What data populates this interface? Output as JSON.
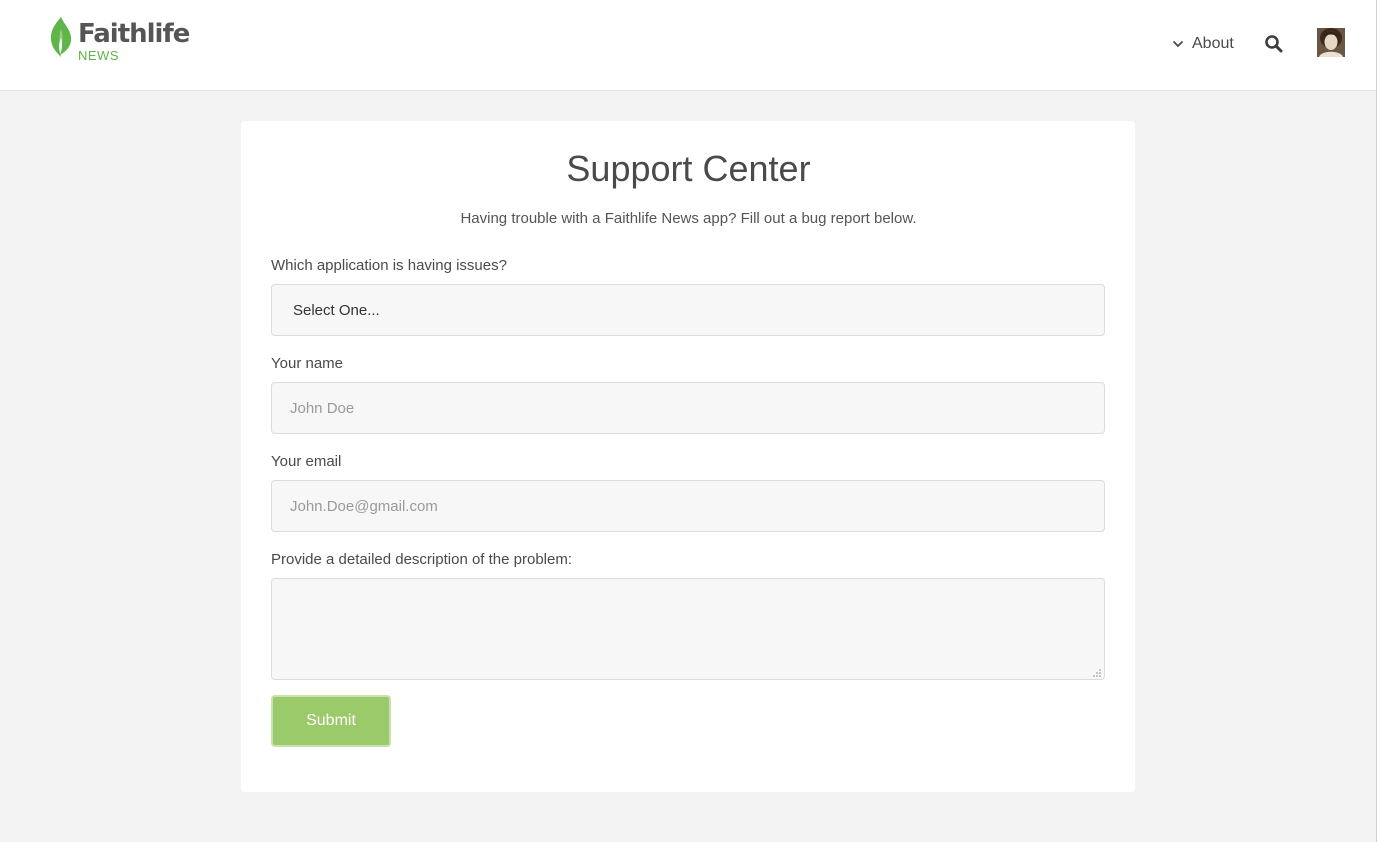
{
  "header": {
    "logo": {
      "word": "Faithlife",
      "sub": "NEWS",
      "icon": "leaf-flame-icon",
      "accent_color": "#5fb547"
    },
    "nav": {
      "about_label": "About",
      "about_icon": "chevron-down-icon",
      "search_icon": "search-icon",
      "avatar_icon": "user-avatar"
    }
  },
  "support": {
    "title": "Support Center",
    "subtitle": "Having trouble with a Faithlife News app? Fill out a bug report below.",
    "fields": {
      "application": {
        "label": "Which application is having issues?",
        "selected": "Select One..."
      },
      "name": {
        "label": "Your name",
        "placeholder": "John Doe",
        "value": ""
      },
      "email": {
        "label": "Your email",
        "placeholder": "John.Doe@gmail.com",
        "value": ""
      },
      "description": {
        "label": "Provide a detailed description of the problem:",
        "value": ""
      }
    },
    "submit_label": "Submit",
    "submit_color": "#9aca6a"
  }
}
